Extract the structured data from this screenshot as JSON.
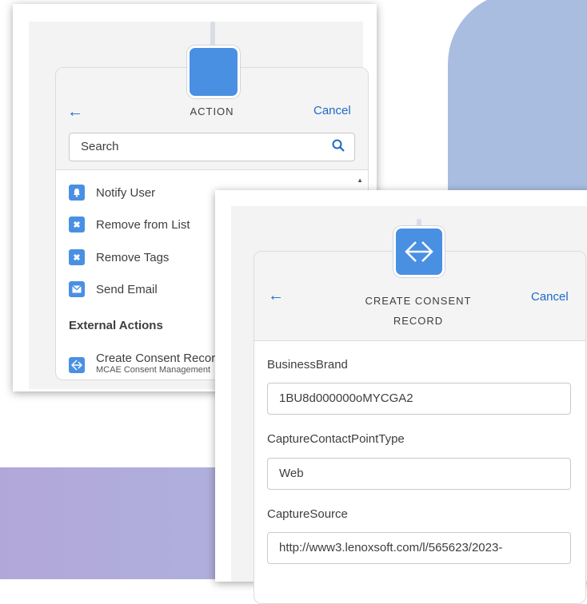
{
  "action_panel": {
    "title": "ACTION",
    "back_icon": "arrow-left-icon",
    "cancel_label": "Cancel",
    "search_placeholder": "Search",
    "items": [
      {
        "label": "Notify User",
        "icon": "bell-icon"
      },
      {
        "label": "Remove from List",
        "icon": "x-icon"
      },
      {
        "label": "Remove Tags",
        "icon": "x-icon"
      },
      {
        "label": "Send Email",
        "icon": "envelope-icon"
      }
    ],
    "section_heading": "External Actions",
    "external_item": {
      "label": "Create Consent Record",
      "sublabel": "MCAE Consent Management",
      "icon": "split-arrows-icon"
    }
  },
  "consent_panel": {
    "title_line1": "CREATE CONSENT",
    "title_line2": "RECORD",
    "cancel_label": "Cancel",
    "fields": [
      {
        "label": "BusinessBrand",
        "value": "1BU8d000000oMYCGA2"
      },
      {
        "label": "CaptureContactPointType",
        "value": "Web"
      },
      {
        "label": "CaptureSource",
        "value": "http://www3.lenoxsoft.com/l/565623/2023-"
      }
    ]
  },
  "colors": {
    "accent": "#4a90e2",
    "link": "#1b6ac9",
    "bg_purple": "#b2a7d9",
    "bg_blue": "#a9bde0"
  }
}
